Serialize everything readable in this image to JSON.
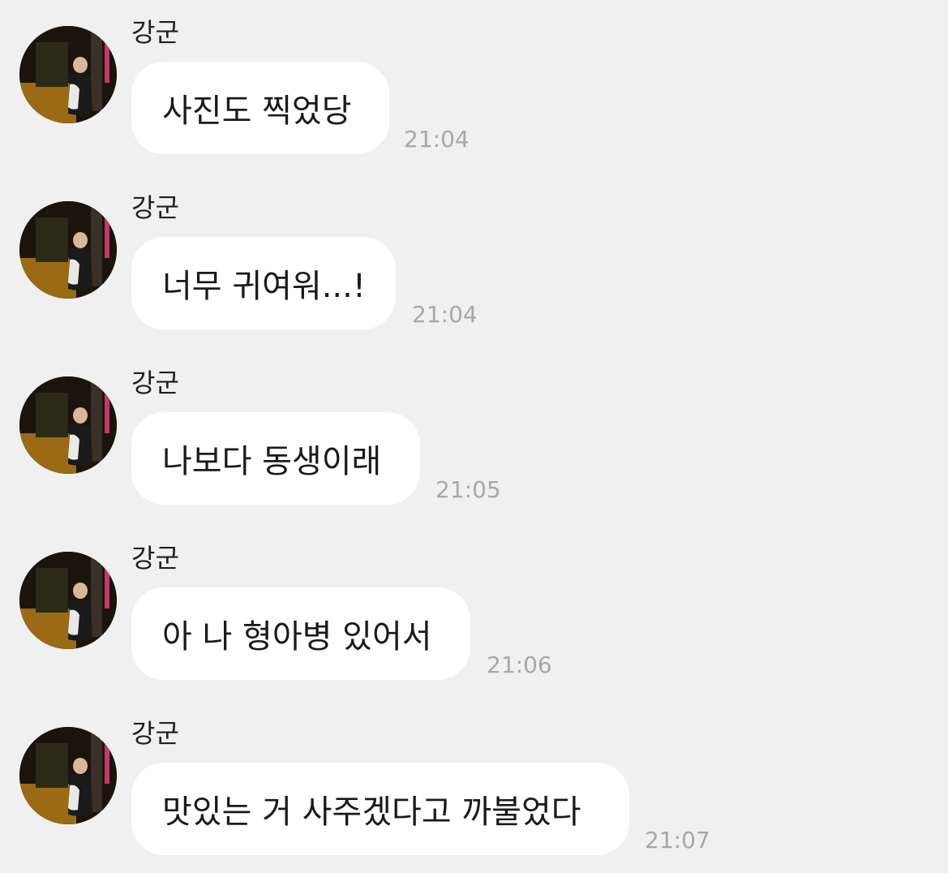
{
  "messages": [
    {
      "sender": "강군",
      "text": "사진도 찍었당",
      "time": "21:04"
    },
    {
      "sender": "강군",
      "text": "너무 귀여워...!",
      "time": "21:04"
    },
    {
      "sender": "강군",
      "text": "나보다 동생이래",
      "time": "21:05"
    },
    {
      "sender": "강군",
      "text": "아 나 형아병 있어서",
      "time": "21:06"
    },
    {
      "sender": "강군",
      "text": "맛있는 거 사주겠다고 까불었다",
      "time": "21:07"
    }
  ],
  "colors": {
    "background": "#f0f0f0",
    "bubble": "#ffffff",
    "time": "#a8a8a8",
    "sender": "#1f1f1f"
  },
  "icons": {
    "avatar": "profile-photo"
  }
}
